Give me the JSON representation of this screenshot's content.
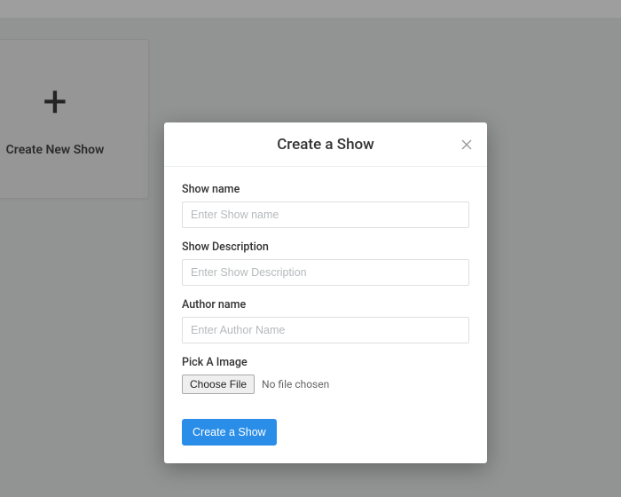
{
  "card": {
    "plus_glyph": "+",
    "label": "Create New Show"
  },
  "modal": {
    "title": "Create a Show",
    "fields": {
      "show_name": {
        "label": "Show name",
        "placeholder": "Enter Show name",
        "value": ""
      },
      "show_description": {
        "label": "Show Description",
        "placeholder": "Enter Show Description",
        "value": ""
      },
      "author_name": {
        "label": "Author name",
        "placeholder": "Enter Author Name",
        "value": ""
      },
      "image": {
        "label": "Pick A Image",
        "button": "Choose File",
        "status": "No file chosen"
      }
    },
    "submit_label": "Create a Show"
  }
}
